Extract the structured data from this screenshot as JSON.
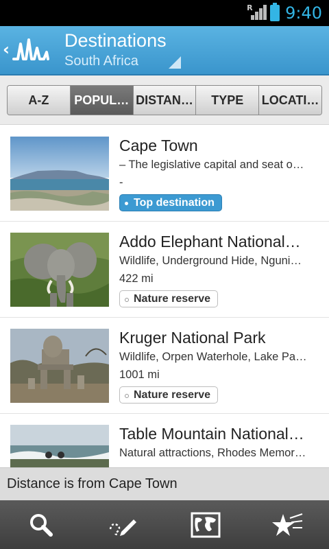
{
  "status_bar": {
    "time": "9:40",
    "roaming_indicator": "R",
    "signal_icon": "signal-icon",
    "battery_icon": "battery-icon"
  },
  "header": {
    "title": "Destinations",
    "subtitle": "South Africa",
    "back_icon": "back-chevron-icon",
    "logo_icon": "app-logo-icon",
    "dropdown_icon": "spinner-triangle-icon"
  },
  "tabs": [
    {
      "label": "A-Z",
      "active": false
    },
    {
      "label": "POPUL…",
      "active": true
    },
    {
      "label": "DISTAN…",
      "active": false
    },
    {
      "label": "TYPE",
      "active": false
    },
    {
      "label": "LOCATI…",
      "active": false
    }
  ],
  "destinations": [
    {
      "title": "Cape Town",
      "description": "– The legislative capital and seat o…",
      "distance": "-",
      "badge": "Top destination",
      "badge_style": "top"
    },
    {
      "title": "Addo Elephant National…",
      "description": "Wildlife, Underground Hide, Nguni…",
      "distance": "422 mi",
      "badge": "Nature reserve",
      "badge_style": "nature"
    },
    {
      "title": "Kruger National Park",
      "description": "Wildlife, Orpen Waterhole, Lake Pa…",
      "distance": "1001 mi",
      "badge": "Nature reserve",
      "badge_style": "nature"
    },
    {
      "title": "Table Mountain National…",
      "description": "Natural attractions, Rhodes Memor…",
      "distance": "",
      "badge": "",
      "badge_style": ""
    }
  ],
  "note": "Distance is from Cape Town",
  "bottom_nav": [
    {
      "icon": "search-icon"
    },
    {
      "icon": "pencil-path-icon"
    },
    {
      "icon": "world-map-icon"
    },
    {
      "icon": "starred-icon"
    }
  ],
  "colors": {
    "header": "#3a95cc",
    "accent": "#33b5e5",
    "badge_top": "#3c9ad2"
  }
}
